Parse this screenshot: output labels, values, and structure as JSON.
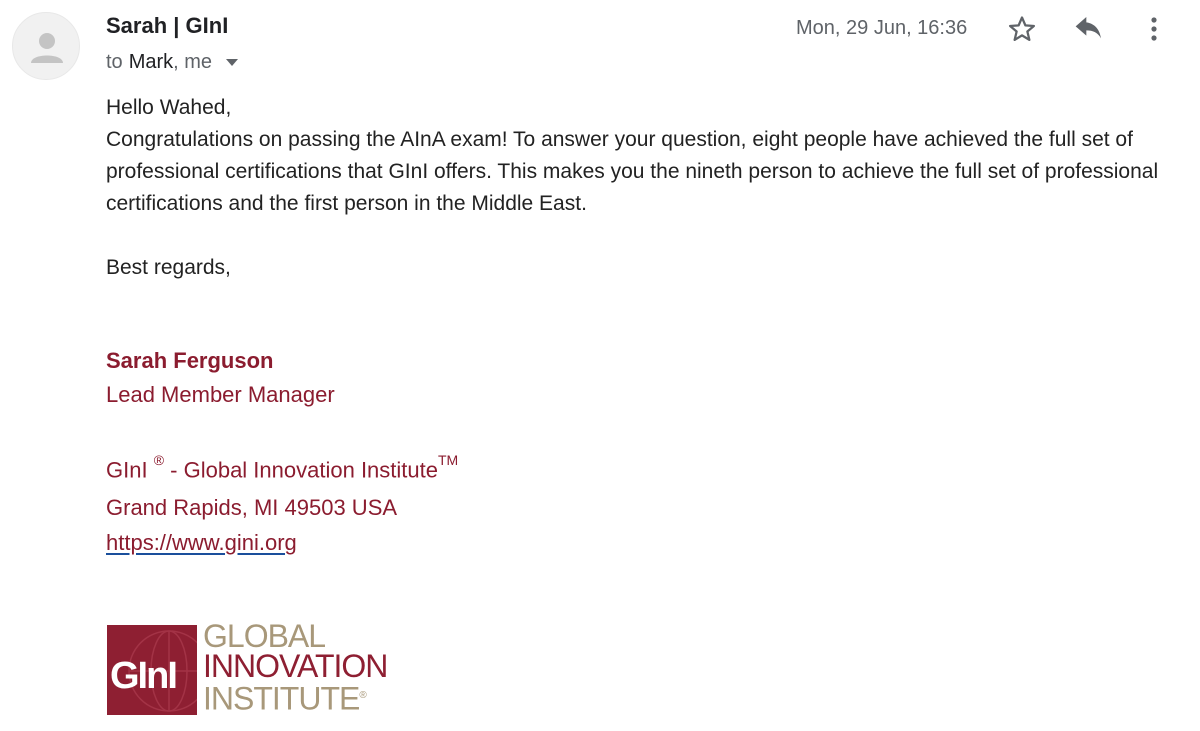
{
  "email": {
    "sender_name": "Sarah | GInI",
    "to_label": "to",
    "recipients": [
      "Mark",
      "me"
    ],
    "date": "Mon, 29 Jun, 16:36"
  },
  "body": {
    "greeting": "Hello Wahed,",
    "message": "Congratulations on passing the AInA exam! To answer your question, eight people have achieved the full set of professional certifications that GInI offers. This makes you the nineth person to achieve the full set of professional certifications and the first person in the Middle East.",
    "closing": "Best regards,"
  },
  "signature": {
    "name": "Sarah Ferguson",
    "title": "Lead Member Manager",
    "org_name": "GInI",
    "org_registered": "®",
    "org_rest": " - Global Innovation Institute",
    "org_trademark": "TM",
    "address": "Grand Rapids, MI  49503  USA",
    "website": "https://www.gini.org"
  },
  "logo": {
    "box_text": "GInI",
    "line1": "GLOBAL",
    "line2": "INNOVATION",
    "line3": "INSTITUTE",
    "line3_mark": "®"
  },
  "icons": {
    "star": "star-icon",
    "reply": "reply-icon",
    "more": "more-vert-icon",
    "avatar": "person-icon",
    "details": "chevron-down-icon"
  },
  "colors": {
    "signature": "#8b1c2f",
    "logo_red": "#8e1f32",
    "logo_tan": "#a8987a",
    "link_underline": "#1a4f9c"
  }
}
